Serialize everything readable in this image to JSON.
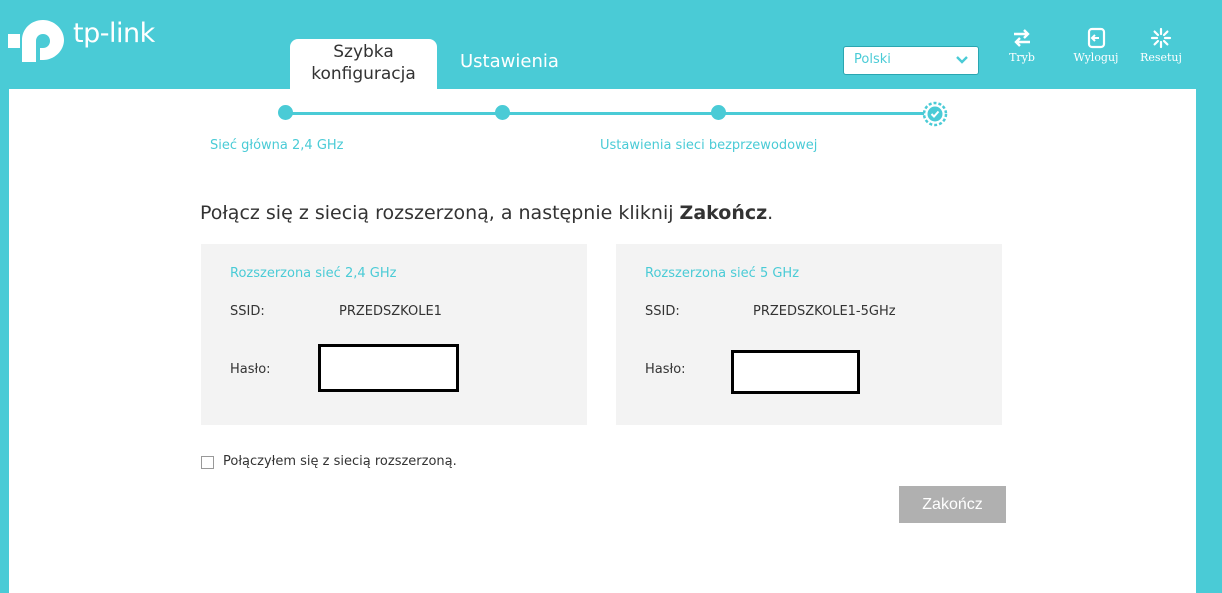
{
  "brand": {
    "name": "tp-link",
    "accent": "#4acbd6"
  },
  "tabs": {
    "quick_setup": "Szybka konfiguracja",
    "settings": "Ustawienia"
  },
  "language": {
    "selected": "Polski"
  },
  "header_buttons": {
    "mode": "Tryb",
    "logout": "Wyloguj",
    "reset": "Resetuj"
  },
  "steps": {
    "step1": "Sieć główna 2,4 GHz",
    "step3": "Ustawienia sieci bezprzewodowej"
  },
  "instruction": {
    "prefix": "Połącz się z siecią rozszerzoną, a następnie kliknij ",
    "bold": "Zakończ",
    "suffix": "."
  },
  "panels": [
    {
      "title": "Rozszerzona sieć 2,4 GHz",
      "ssid_label": "SSID:",
      "ssid": "PRZEDSZKOLE1",
      "password_label": "Hasło:"
    },
    {
      "title": "Rozszerzona sieć 5 GHz",
      "ssid_label": "SSID:",
      "ssid": "PRZEDSZKOLE1-5GHz",
      "password_label": "Hasło:"
    }
  ],
  "confirm_checkbox": {
    "label": "Połączyłem się z siecią rozszerzoną."
  },
  "finish_button": {
    "label": "Zakończ"
  }
}
